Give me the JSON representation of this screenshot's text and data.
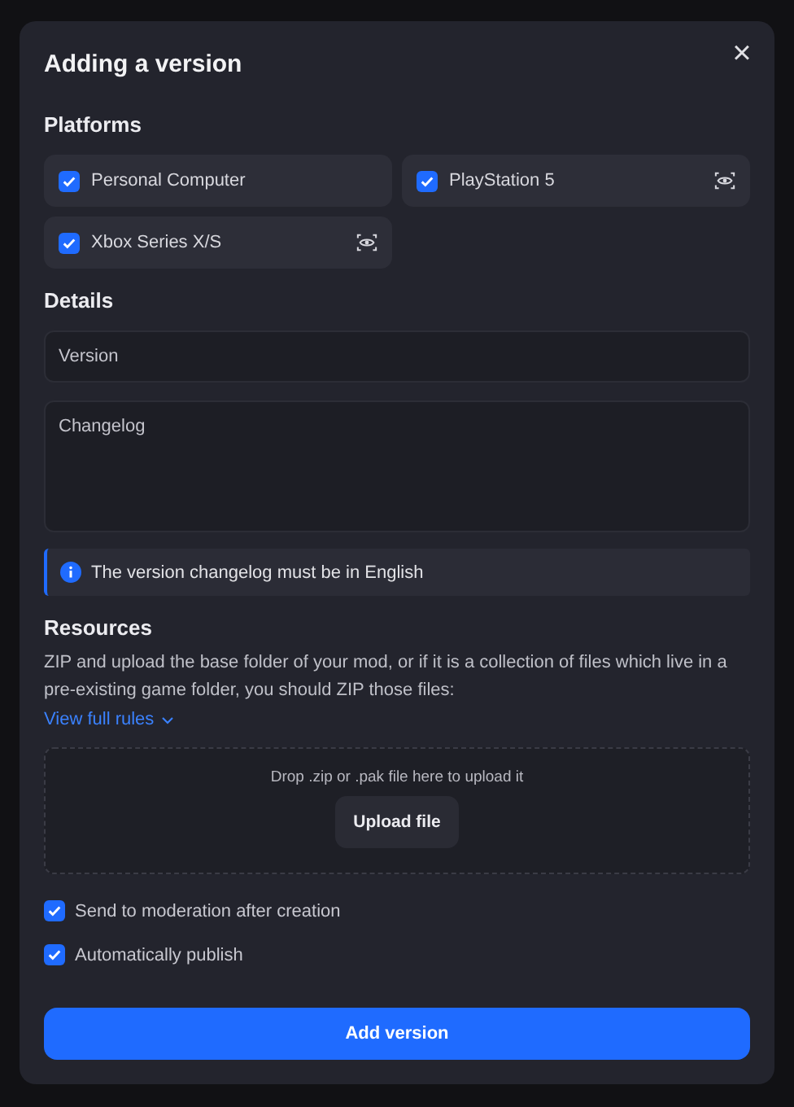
{
  "dialog": {
    "title": "Adding a version",
    "close": "×"
  },
  "platforms": {
    "heading": "Platforms",
    "items": [
      {
        "label": "Personal Computer",
        "checked": true,
        "preview": false
      },
      {
        "label": "PlayStation 5",
        "checked": true,
        "preview": true
      },
      {
        "label": "Xbox Series X/S",
        "checked": true,
        "preview": true
      }
    ]
  },
  "details": {
    "heading": "Details",
    "version": {
      "placeholder": "Version"
    },
    "changelog": {
      "placeholder": "Changelog"
    },
    "notice": "The version changelog must be in English"
  },
  "resources": {
    "heading": "Resources",
    "description": "ZIP and upload the base folder of your mod, or if it is a collection of files which live in a pre-existing game folder, you should ZIP those files:",
    "rules_link": "View full rules",
    "dropzone_hint": "Drop .zip or .pak file here to upload it",
    "upload_button": "Upload file"
  },
  "options": [
    {
      "label": "Send to moderation after creation",
      "checked": true
    },
    {
      "label": "Automatically publish",
      "checked": true
    }
  ],
  "submit": "Add version"
}
